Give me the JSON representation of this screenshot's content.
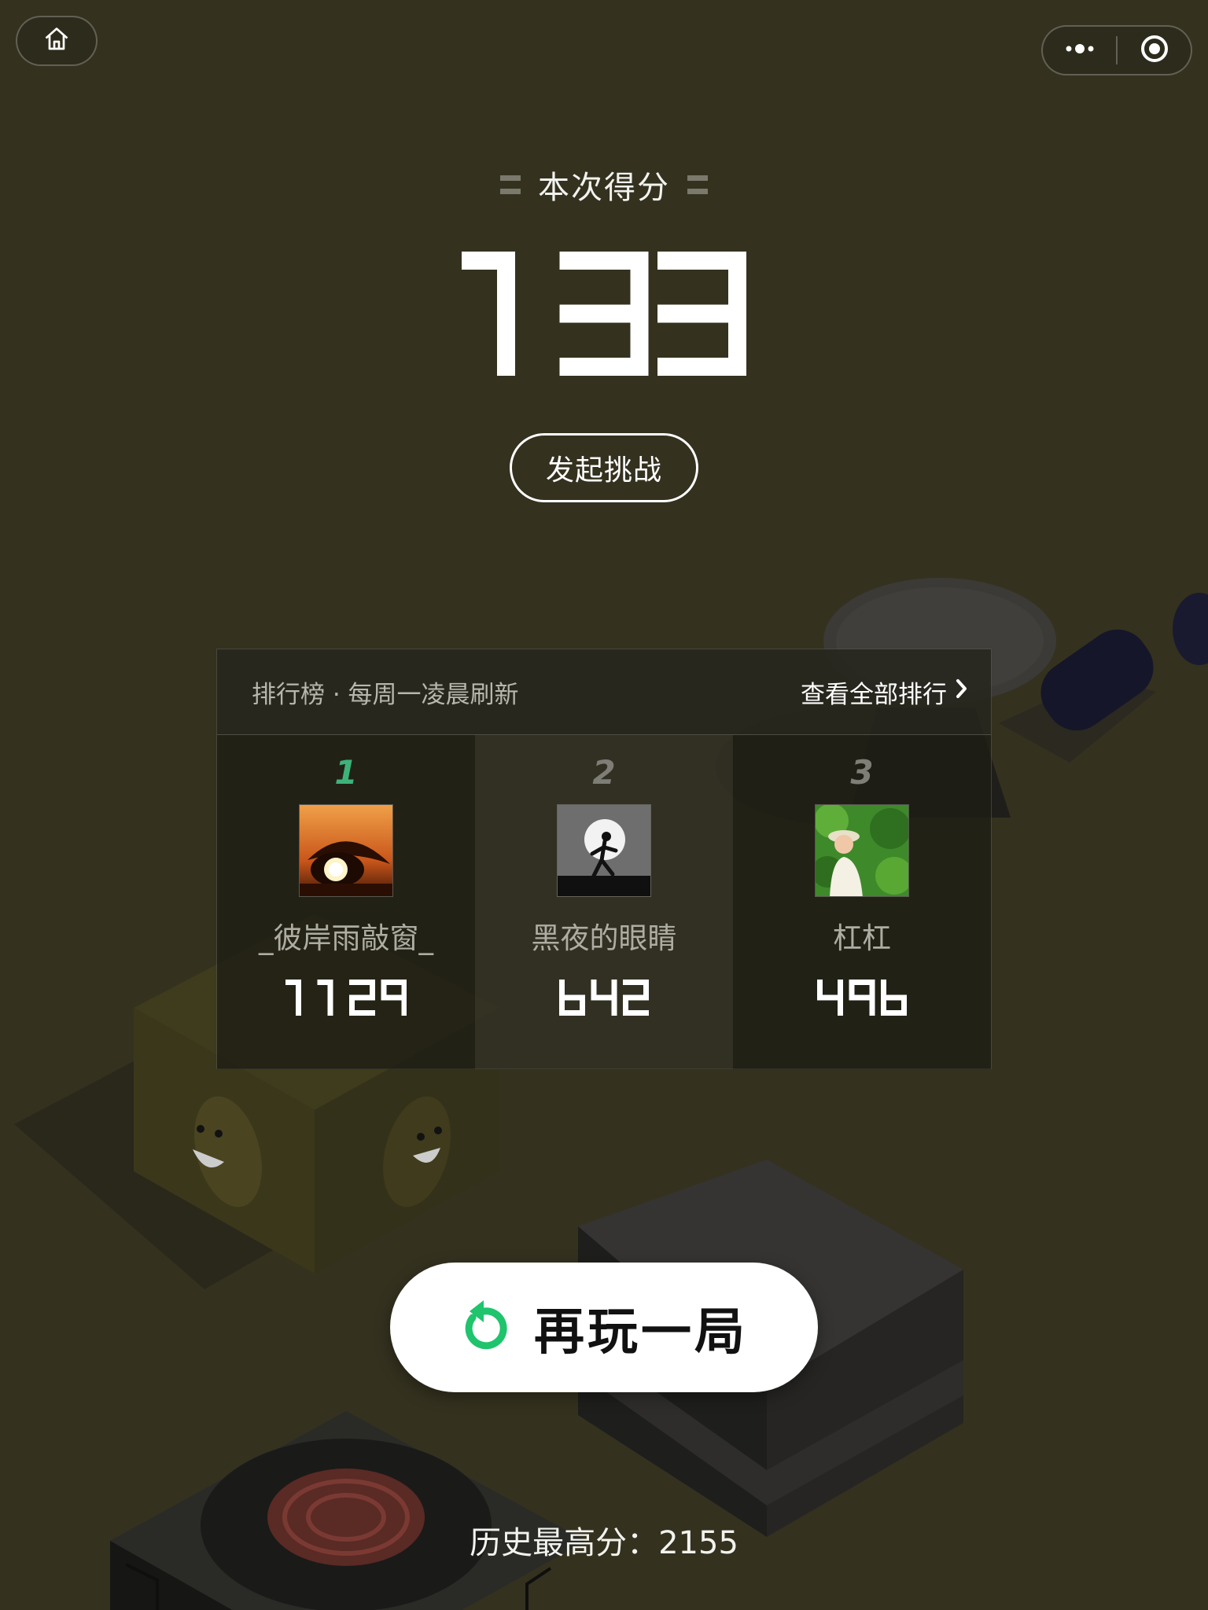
{
  "top_bar": {
    "home_icon": "home-icon",
    "more_icon": "more-dots-icon",
    "close_icon": "record-close-icon"
  },
  "score": {
    "label": "本次得分",
    "value": "133"
  },
  "challenge_label": "发起挑战",
  "leaderboard": {
    "title": "排行榜 · 每周一凌晨刷新",
    "view_all": "查看全部排行",
    "entries": [
      {
        "rank": "1",
        "name": "_彼岸雨敲窗_",
        "score": "1129",
        "rank_color": "#3db37a"
      },
      {
        "rank": "2",
        "name": "黑夜的眼睛",
        "score": "642",
        "rank_color": "#7e7d76"
      },
      {
        "rank": "3",
        "name": "杠杠",
        "score": "496",
        "rank_color": "#7e7d76"
      }
    ]
  },
  "play_again": {
    "label": "再玩一局",
    "icon": "restart-icon",
    "icon_color": "#1fc46d"
  },
  "best": {
    "text": "历史最高分：2155"
  },
  "colors": {
    "background": "#34311f",
    "accent_green": "#1fc46d"
  }
}
